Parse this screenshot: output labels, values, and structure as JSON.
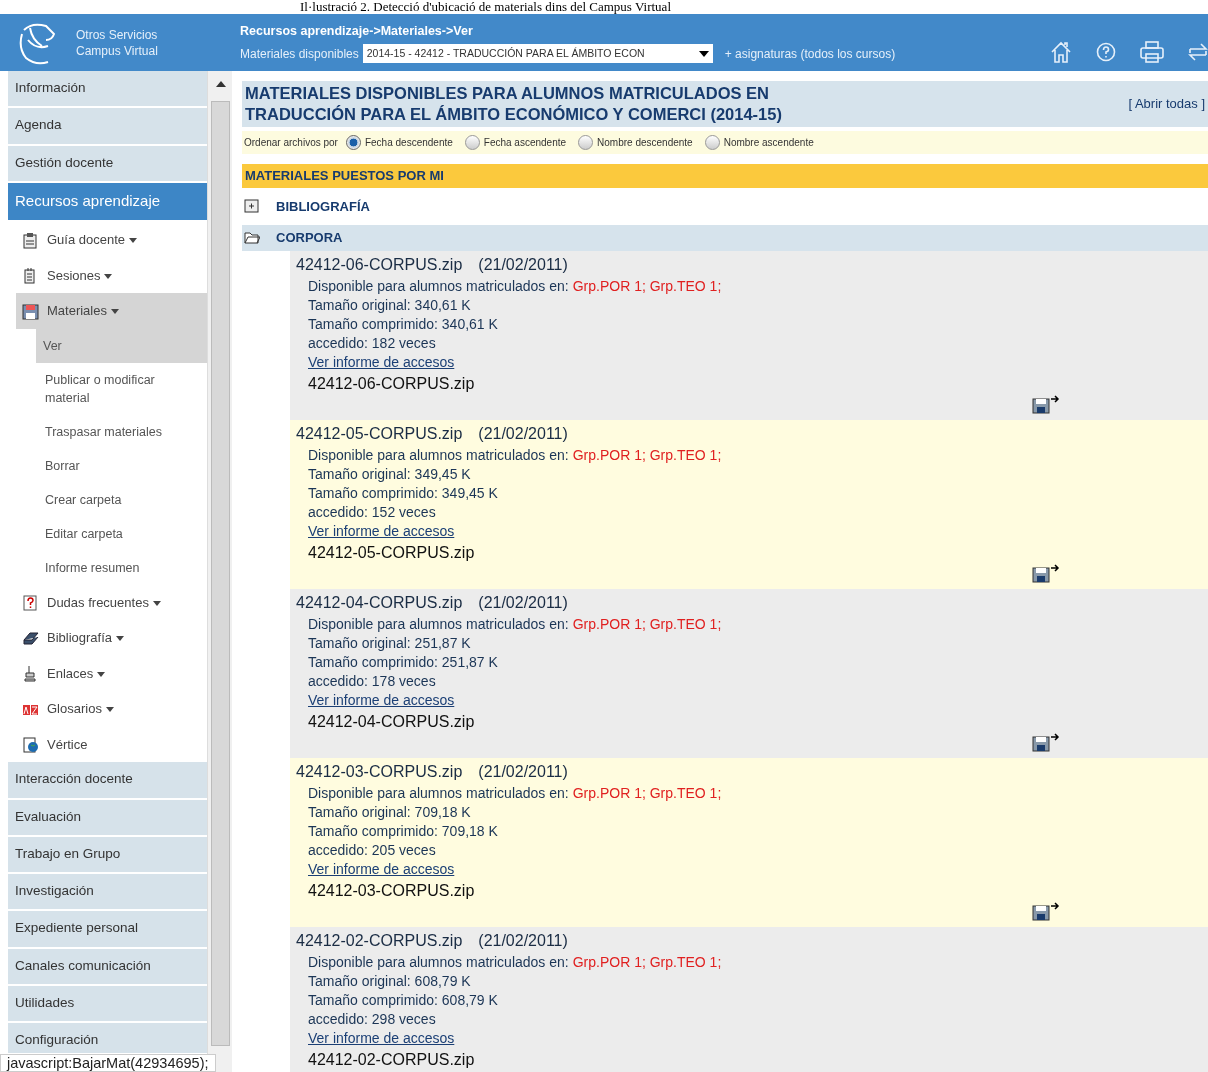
{
  "caption": "Il·lustració 2. Detecció d'ubicació de materials dins del Campus Virtual",
  "header": {
    "logo_text": [
      "Otros Servicios",
      "Campus Virtual"
    ],
    "breadcrumb": "Recursos aprendizaje->Materiales->Ver",
    "select_label": "Materiales disponibles",
    "select_value": "2014-15 - 42412 - TRADUCCIÓN PARA EL ÁMBITO ECON",
    "more_link": "+ asignaturas (todos los cursos)"
  },
  "sidebar": {
    "items": [
      {
        "label": "Información",
        "kind": "section",
        "selected": false
      },
      {
        "label": "Agenda",
        "kind": "section",
        "selected": false
      },
      {
        "label": "Gestión docente",
        "kind": "section",
        "selected": false
      },
      {
        "label": "Recursos aprendizaje",
        "kind": "section",
        "selected": true
      },
      {
        "label": "Guía docente",
        "kind": "tool",
        "expanded": false
      },
      {
        "label": "Sesiones",
        "kind": "tool",
        "expanded": false
      },
      {
        "label": "Materiales",
        "kind": "tool",
        "expanded": true,
        "children": [
          {
            "label": "Ver",
            "selected": true
          },
          {
            "label": "Publicar o modificar material",
            "selected": false
          },
          {
            "label": "Traspasar materiales",
            "selected": false
          },
          {
            "label": "Borrar",
            "selected": false
          },
          {
            "label": "Crear carpeta",
            "selected": false
          },
          {
            "label": "Editar carpeta",
            "selected": false
          },
          {
            "label": "Informe resumen",
            "selected": false
          }
        ]
      },
      {
        "label": "Dudas frecuentes",
        "kind": "tool",
        "expanded": false
      },
      {
        "label": "Bibliografía",
        "kind": "tool",
        "expanded": false
      },
      {
        "label": "Enlaces",
        "kind": "tool",
        "expanded": false
      },
      {
        "label": "Glosarios",
        "kind": "tool",
        "expanded": false
      },
      {
        "label": "Vértice",
        "kind": "link"
      },
      {
        "label": "Interacción docente",
        "kind": "section",
        "selected": false
      },
      {
        "label": "Evaluación",
        "kind": "section",
        "selected": false
      },
      {
        "label": "Trabajo en Grupo",
        "kind": "section",
        "selected": false
      },
      {
        "label": "Investigación",
        "kind": "section",
        "selected": false
      },
      {
        "label": "Expediente personal",
        "kind": "section",
        "selected": false
      },
      {
        "label": "Canales comunicación",
        "kind": "section",
        "selected": false
      },
      {
        "label": "Utilidades",
        "kind": "section",
        "selected": false
      },
      {
        "label": "Configuración",
        "kind": "section",
        "selected": false
      }
    ]
  },
  "status_text": "javascript:BajarMat(42934695);",
  "main": {
    "title": "MATERIALES DISPONIBLES PARA ALUMNOS MATRICULADOS EN TRADUCCIÓN PARA EL ÁMBITO ECONÓMICO Y COMERCI (2014-15)",
    "open_all": "[ Abrir todas ]",
    "sort_label": "Ordenar archivos por",
    "sort_options": [
      {
        "label": "Fecha descendente",
        "selected": true
      },
      {
        "label": "Fecha ascendente",
        "selected": false
      },
      {
        "label": "Nombre descendente",
        "selected": false
      },
      {
        "label": "Nombre ascendente",
        "selected": false
      }
    ],
    "section_title": "MATERIALES PUESTOS POR MI",
    "folders": [
      {
        "label": "BIBLIOGRAFÍA",
        "expanded": false
      },
      {
        "label": "CORPORA",
        "expanded": true
      }
    ],
    "files": [
      {
        "name": "42412-06-CORPUS.zip",
        "date": "(21/02/2011)",
        "available_label": "Disponible para alumnos matriculados en:",
        "groups": "Grp.POR 1; Grp.TEO 1;",
        "original_size": "Tamaño original: 340,61 K",
        "compressed_size": "Tamaño comprimido: 340,61 K",
        "accessed": "accedido: 182 veces",
        "report_link": "Ver informe de accesos",
        "file_link": "42412-06-CORPUS.zip"
      },
      {
        "name": "42412-05-CORPUS.zip",
        "date": "(21/02/2011)",
        "available_label": "Disponible para alumnos matriculados en:",
        "groups": "Grp.POR 1; Grp.TEO 1;",
        "original_size": "Tamaño original: 349,45 K",
        "compressed_size": "Tamaño comprimido: 349,45 K",
        "accessed": "accedido: 152 veces",
        "report_link": "Ver informe de accesos",
        "file_link": "42412-05-CORPUS.zip"
      },
      {
        "name": "42412-04-CORPUS.zip",
        "date": "(21/02/2011)",
        "available_label": "Disponible para alumnos matriculados en:",
        "groups": "Grp.POR 1; Grp.TEO 1;",
        "original_size": "Tamaño original: 251,87 K",
        "compressed_size": "Tamaño comprimido: 251,87 K",
        "accessed": "accedido: 178 veces",
        "report_link": "Ver informe de accesos",
        "file_link": "42412-04-CORPUS.zip"
      },
      {
        "name": "42412-03-CORPUS.zip",
        "date": "(21/02/2011)",
        "available_label": "Disponible para alumnos matriculados en:",
        "groups": "Grp.POR 1; Grp.TEO 1;",
        "original_size": "Tamaño original: 709,18 K",
        "compressed_size": "Tamaño comprimido: 709,18 K",
        "accessed": "accedido: 205 veces",
        "report_link": "Ver informe de accesos",
        "file_link": "42412-03-CORPUS.zip"
      },
      {
        "name": "42412-02-CORPUS.zip",
        "date": "(21/02/2011)",
        "available_label": "Disponible para alumnos matriculados en:",
        "groups": "Grp.POR 1; Grp.TEO 1;",
        "original_size": "Tamaño original: 608,79 K",
        "compressed_size": "Tamaño comprimido: 608,79 K",
        "accessed": "accedido: 298 veces",
        "report_link": "Ver informe de accesos",
        "file_link": "42412-02-CORPUS.zip"
      }
    ]
  }
}
